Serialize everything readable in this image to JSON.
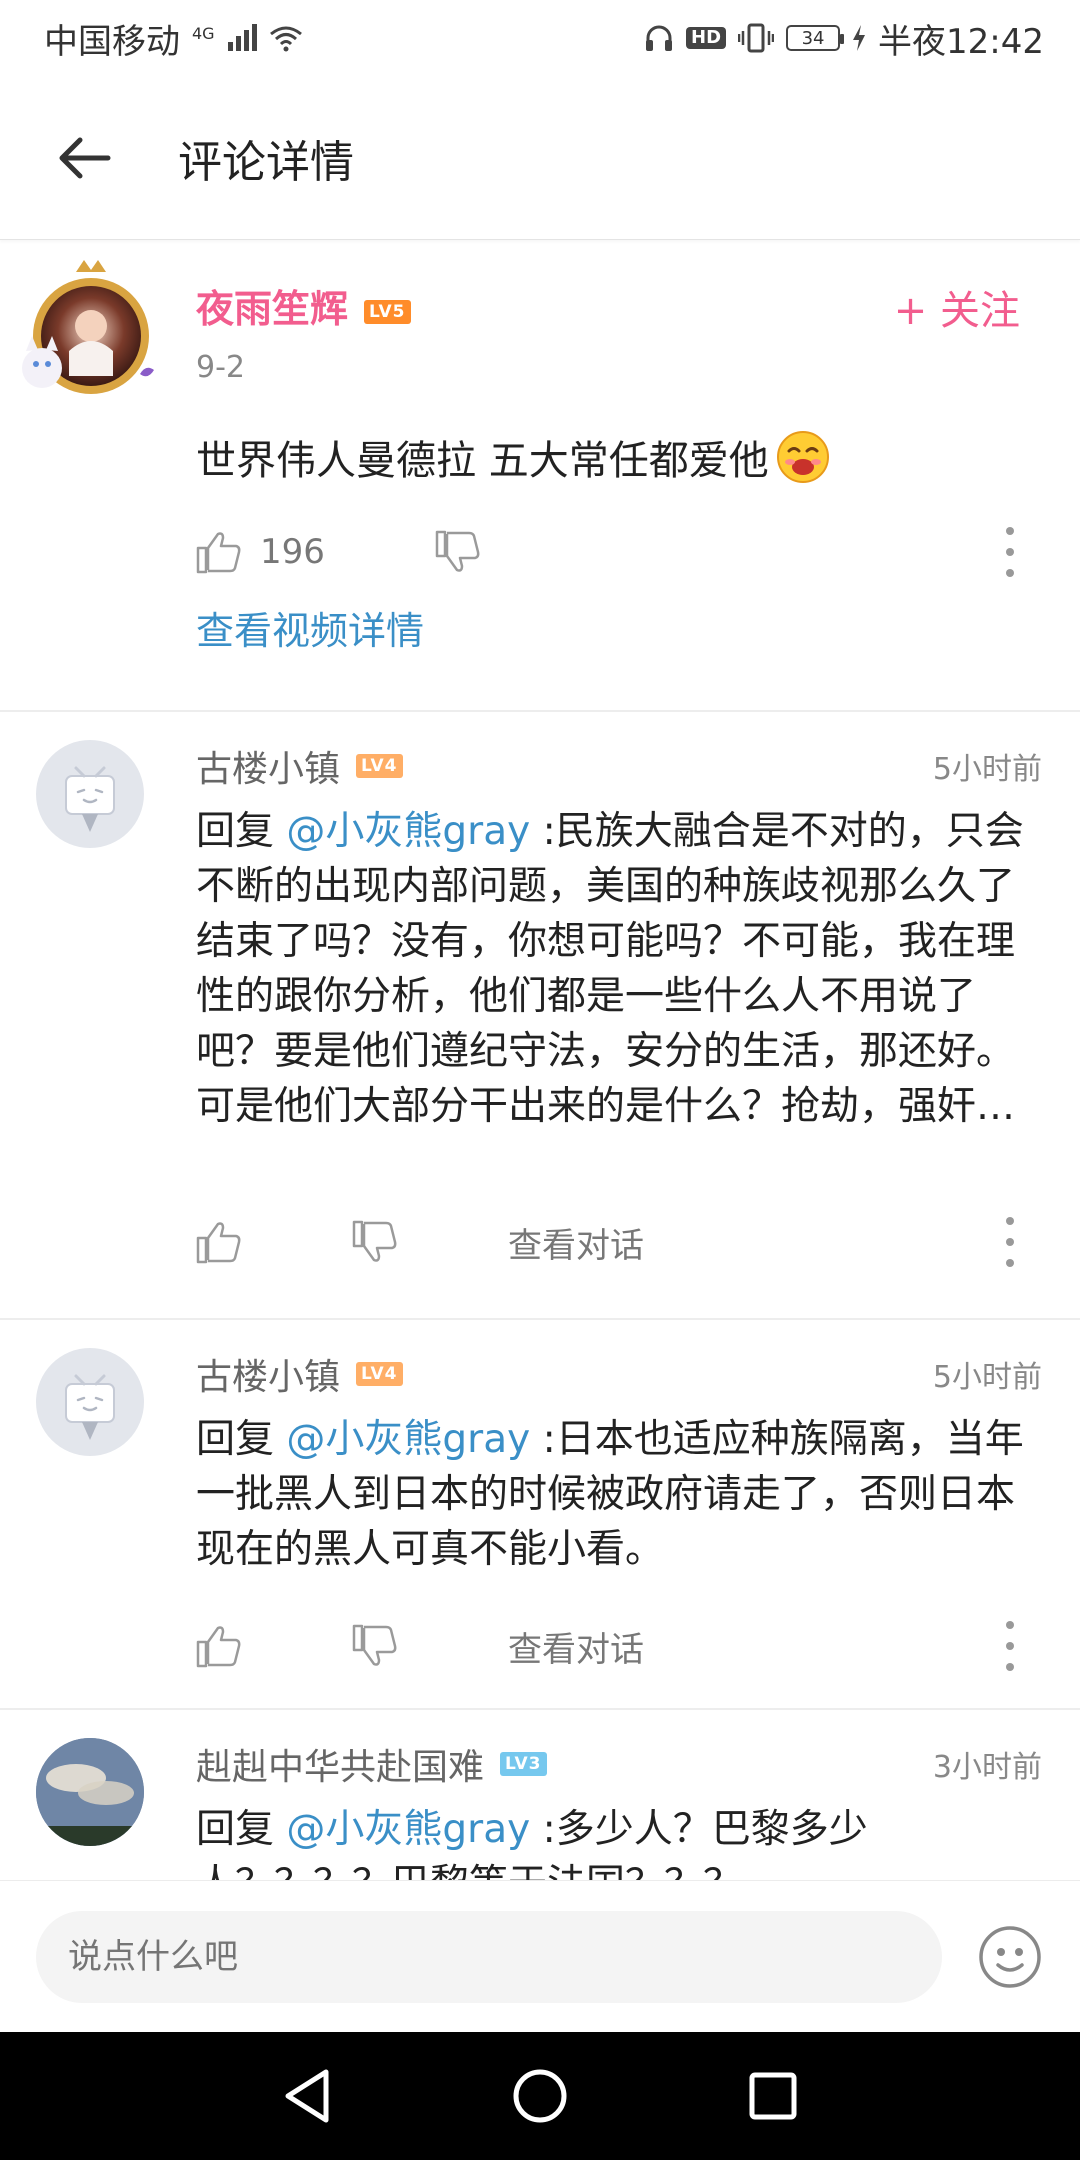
{
  "status_bar": {
    "carrier": "中国移动",
    "network": "4G",
    "battery": "34",
    "time": "半夜12:42"
  },
  "header": {
    "title": "评论详情"
  },
  "main_comment": {
    "username": "夜雨笙辉",
    "level": "LV5",
    "follow_label": "+ 关注",
    "date": "9-2",
    "text": "世界伟人曼德拉 五大常任都爱他",
    "likes": "196",
    "video_link": "查看视频详情"
  },
  "replies": [
    {
      "username": "古楼小镇",
      "level": "LV4",
      "time": "5小时前",
      "prefix": "回复 ",
      "mention": "@小灰熊gray",
      "text": " :民族大融合是不对的，只会不断的出现内部问题，美国的种族歧视那么久了结束了吗？没有，你想可能吗？不可能，我在理性的跟你分析，他们都是一些什么人不用说了吧？要是他们遵纪守法，安分的生活，那还好。可是他们大部分干出来的是什么？抢劫，强奸…",
      "view_convo": "查看对话"
    },
    {
      "username": "古楼小镇",
      "level": "LV4",
      "time": "5小时前",
      "prefix": "回复 ",
      "mention": "@小灰熊gray",
      "text": " :日本也适应种族隔离，当年一批黑人到日本的时候被政府请走了，否则日本现在的黑人可真不能小看。",
      "view_convo": "查看对话"
    },
    {
      "username": "赳赳中华共赴国难",
      "level": "LV3",
      "time": "3小时前",
      "prefix": "回复 ",
      "mention": "@小灰熊gray",
      "text": " :多少人？巴黎多少人？？？？巴黎等于法国？？？"
    }
  ],
  "bottom_bar": {
    "input_placeholder": "说点什么吧"
  },
  "colors": {
    "accent_pink": "#f25d8e",
    "link_blue": "#3a8fc7"
  }
}
